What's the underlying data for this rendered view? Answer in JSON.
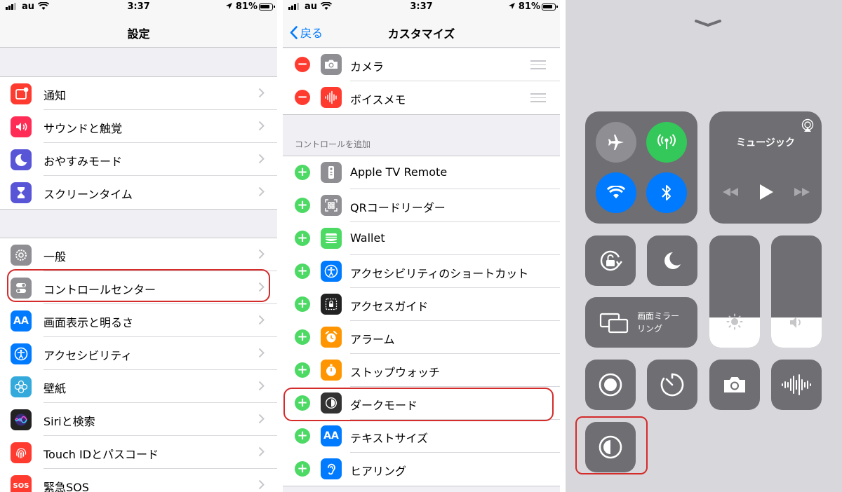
{
  "status": {
    "carrier": "au",
    "time": "3:37",
    "battery": "81%"
  },
  "settings": {
    "title": "設定",
    "group1": [
      {
        "label": "通知",
        "icon": "notifications-icon",
        "color": "#ff3b30"
      },
      {
        "label": "サウンドと触覚",
        "icon": "sound-icon",
        "color": "#ff2d55"
      },
      {
        "label": "おやすみモード",
        "icon": "moon-icon",
        "color": "#5856d6"
      },
      {
        "label": "スクリーンタイム",
        "icon": "hourglass-icon",
        "color": "#5856d6"
      }
    ],
    "group2": [
      {
        "label": "一般",
        "icon": "gear-icon",
        "color": "#8e8e93"
      },
      {
        "label": "コントロールセンター",
        "icon": "toggles-icon",
        "color": "#8e8e93"
      },
      {
        "label": "画面表示と明るさ",
        "icon": "aa-icon",
        "color": "#007aff",
        "glyph": "AA"
      },
      {
        "label": "アクセシビリティ",
        "icon": "accessibility-icon",
        "color": "#007aff"
      },
      {
        "label": "壁紙",
        "icon": "wallpaper-icon",
        "color": "#34aadc"
      },
      {
        "label": "Siriと検索",
        "icon": "siri-icon",
        "color": "#222"
      },
      {
        "label": "Touch IDとパスコード",
        "icon": "fingerprint-icon",
        "color": "#ff3b30"
      },
      {
        "label": "緊急SOS",
        "icon": "sos-icon",
        "color": "#ff3b30",
        "glyph": "SOS"
      }
    ]
  },
  "customize": {
    "back": "戻る",
    "title": "カスタマイズ",
    "included": [
      {
        "label": "カメラ",
        "icon": "camera-icon",
        "color": "#8e8e93"
      },
      {
        "label": "ボイスメモ",
        "icon": "voice-memo-icon",
        "color": "#ff3b30"
      }
    ],
    "add_header": "コントロールを追加",
    "more": [
      {
        "label": "Apple TV Remote",
        "icon": "remote-icon",
        "color": "#8e8e93"
      },
      {
        "label": "QRコードリーダー",
        "icon": "qr-icon",
        "color": "#8e8e93"
      },
      {
        "label": "Wallet",
        "icon": "wallet-icon",
        "color": "#4cd964"
      },
      {
        "label": "アクセシビリティのショートカット",
        "icon": "accessibility-icon",
        "color": "#007aff"
      },
      {
        "label": "アクセスガイド",
        "icon": "lock-icon",
        "color": "#222"
      },
      {
        "label": "アラーム",
        "icon": "alarm-icon",
        "color": "#ff9500"
      },
      {
        "label": "ストップウォッチ",
        "icon": "stopwatch-icon",
        "color": "#ff9500"
      },
      {
        "label": "ダークモード",
        "icon": "dark-mode-icon",
        "color": "#333"
      },
      {
        "label": "テキストサイズ",
        "icon": "text-size-icon",
        "color": "#007aff",
        "glyph": "AA"
      },
      {
        "label": "ヒアリング",
        "icon": "ear-icon",
        "color": "#007aff"
      }
    ]
  },
  "control_center": {
    "music_title": "ミュージック",
    "mirroring": "画面ミラー\nリング",
    "brightness_level": 0.27,
    "volume_level": 0.27
  }
}
